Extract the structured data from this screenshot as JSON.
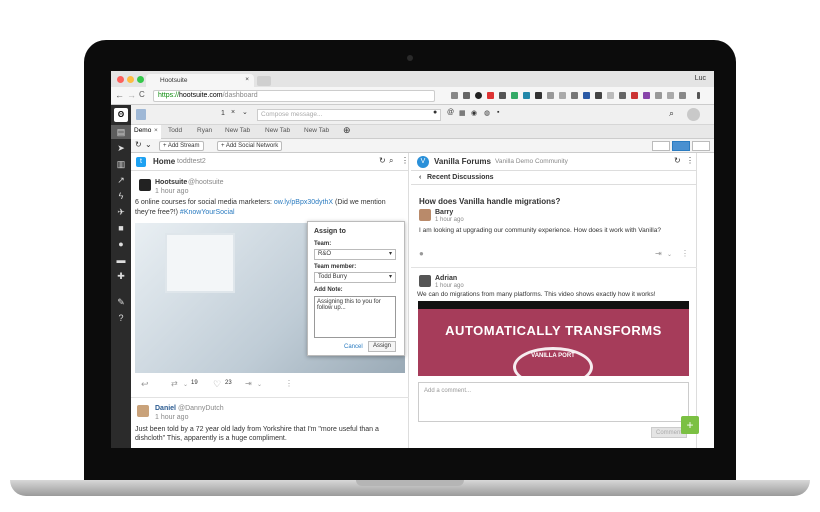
{
  "browser": {
    "tab_title": "Hootsuite",
    "tab_close": "×",
    "profile_name": "Luc",
    "url_scheme": "https://",
    "url_host": "hootsuite.com",
    "url_path": "/dashboard",
    "back": "←",
    "forward": "→",
    "reload": "C"
  },
  "top": {
    "counter_value": "1",
    "compose_placeholder": "Compose message..."
  },
  "tabs": [
    {
      "label": "Demo"
    },
    {
      "label": "Todd"
    },
    {
      "label": "Ryan"
    },
    {
      "label": "New Tab"
    },
    {
      "label": "New Tab"
    },
    {
      "label": "New Tab"
    }
  ],
  "toolbar": {
    "add_stream": "+ Add Stream",
    "add_social_network": "+ Add Social Network"
  },
  "home_stream": {
    "title": "Home",
    "account": "toddtest2",
    "post1": {
      "author": "Hootsuite",
      "handle": "@hootsuite",
      "time": "1 hour ago",
      "text_before": "6 online courses for social media marketers:",
      "link": "ow.ly/pBpx30dythX",
      "text_after": "(Did we mention they're free?!)",
      "hashtag": "#KnowYourSocial",
      "retweets": "19",
      "likes": "23"
    },
    "post2": {
      "author": "Daniel",
      "handle": "@DannyDutch",
      "time": "1 hour ago",
      "text": "Just been told by a 72 year old lady from Yorkshire that I'm \"more useful than a dishcloth\" This, apparently is a huge compliment."
    }
  },
  "assign_popup": {
    "title": "Assign to",
    "team_label": "Team:",
    "team_value": "R&O",
    "member_label": "Team member:",
    "member_value": "Todd Burry",
    "note_label": "Add Note:",
    "note_value": "Assigning this to you for follow up...",
    "cancel": "Cancel",
    "assign": "Assign"
  },
  "vanilla_stream": {
    "title": "Vanilla Forums",
    "subtitle": "Vanilla Demo Community",
    "back_label": "Recent Discussions",
    "question": "How does Vanilla handle migrations?",
    "q_author": "Barry",
    "q_time": "1 hour ago",
    "q_text": "I am looking at upgrading our community experience. How does it work with Vanilla?",
    "a_author": "Adrian",
    "a_time": "1 hour ago",
    "a_text": "We can do migrations from many platforms. This video shows exactly how it works!",
    "banner_text": "AUTOMATICALLY TRANSFORMS",
    "banner_sub": "VANILLA PORT",
    "comment_placeholder": "Add a comment...",
    "comment_button": "Comment",
    "fab": "+"
  }
}
